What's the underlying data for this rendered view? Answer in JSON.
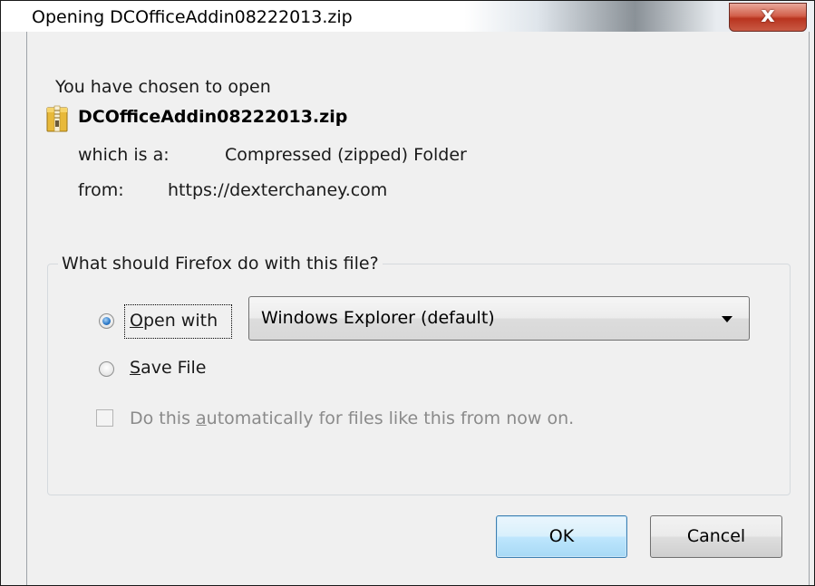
{
  "window": {
    "title": "Opening  DCOfficeAddin08222013.zip",
    "close_label": "x"
  },
  "intro": {
    "chosen_text": "You have chosen to open"
  },
  "file": {
    "name": "DCOfficeAddin08222013.zip",
    "icon": "zip-folder-icon",
    "type_label": "which is a:",
    "type_value": "Compressed (zipped) Folder",
    "from_label": "from:",
    "from_value": "https://dexterchaney.com"
  },
  "action_group": {
    "legend": "What should Firefox do with this file?",
    "open_with": {
      "access_key": "O",
      "label_rest": "pen with",
      "checked": true
    },
    "app_select": {
      "value": "Windows Explorer (default)"
    },
    "save_file": {
      "access_key": "S",
      "label_rest": "ave File",
      "checked": false
    },
    "auto": {
      "prefix": "Do this ",
      "access_key": "a",
      "suffix": "utomatically for files like this from now on.",
      "checked": false,
      "disabled": true
    }
  },
  "buttons": {
    "ok": "OK",
    "cancel": "Cancel"
  },
  "colors": {
    "close_button": "#c9442e",
    "default_button_border": "#3c7fb1",
    "radio_selected": "#2a78c8"
  }
}
